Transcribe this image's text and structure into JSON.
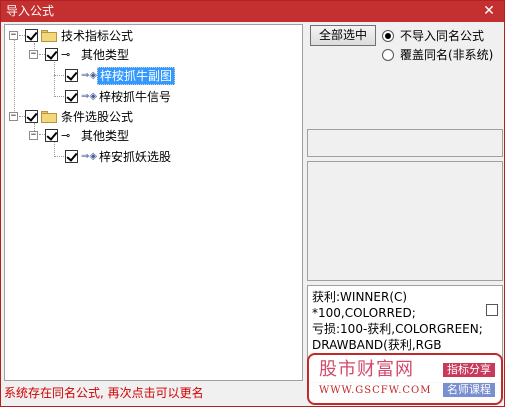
{
  "window": {
    "title": "导入公式",
    "close_glyph": "✕"
  },
  "tree": {
    "groups": [
      {
        "label": "技术指标公式",
        "children": [
          {
            "label": "其他类型",
            "children": [
              {
                "label": "梓桉抓牛副图",
                "selected": true
              },
              {
                "label": "梓桉抓牛信号",
                "selected": false
              }
            ]
          }
        ]
      },
      {
        "label": "条件选股公式",
        "children": [
          {
            "label": "其他类型",
            "children": [
              {
                "label": "梓安抓妖选股",
                "selected": false
              }
            ]
          }
        ]
      }
    ]
  },
  "controls": {
    "select_all_label": "全部选中",
    "radio_skip_label": "不导入同名公式",
    "radio_overwrite_label": "覆盖同名(非系统)",
    "selected_option": "radio_skip"
  },
  "code_preview": {
    "lines": [
      "获利:WINNER(C)",
      "*100,COLORRED;",
      "亏损:100-获利,COLORGREEN;",
      "DRAWBAND(获利,RGB"
    ]
  },
  "watermark": {
    "title": "股市财富网",
    "url": "WWW.GSCFW.COM",
    "tag1": "指标分享",
    "tag2": "名师课程"
  },
  "status_text": "系统存在同名公式, 再次点击可以更名",
  "colors": {
    "titlebar": "#c42f2f",
    "selection": "#3399ff",
    "status": "#d10000"
  },
  "icons": {
    "folder": "folder-icon",
    "formula_type": "key-icon",
    "formula": "formula-icon"
  }
}
